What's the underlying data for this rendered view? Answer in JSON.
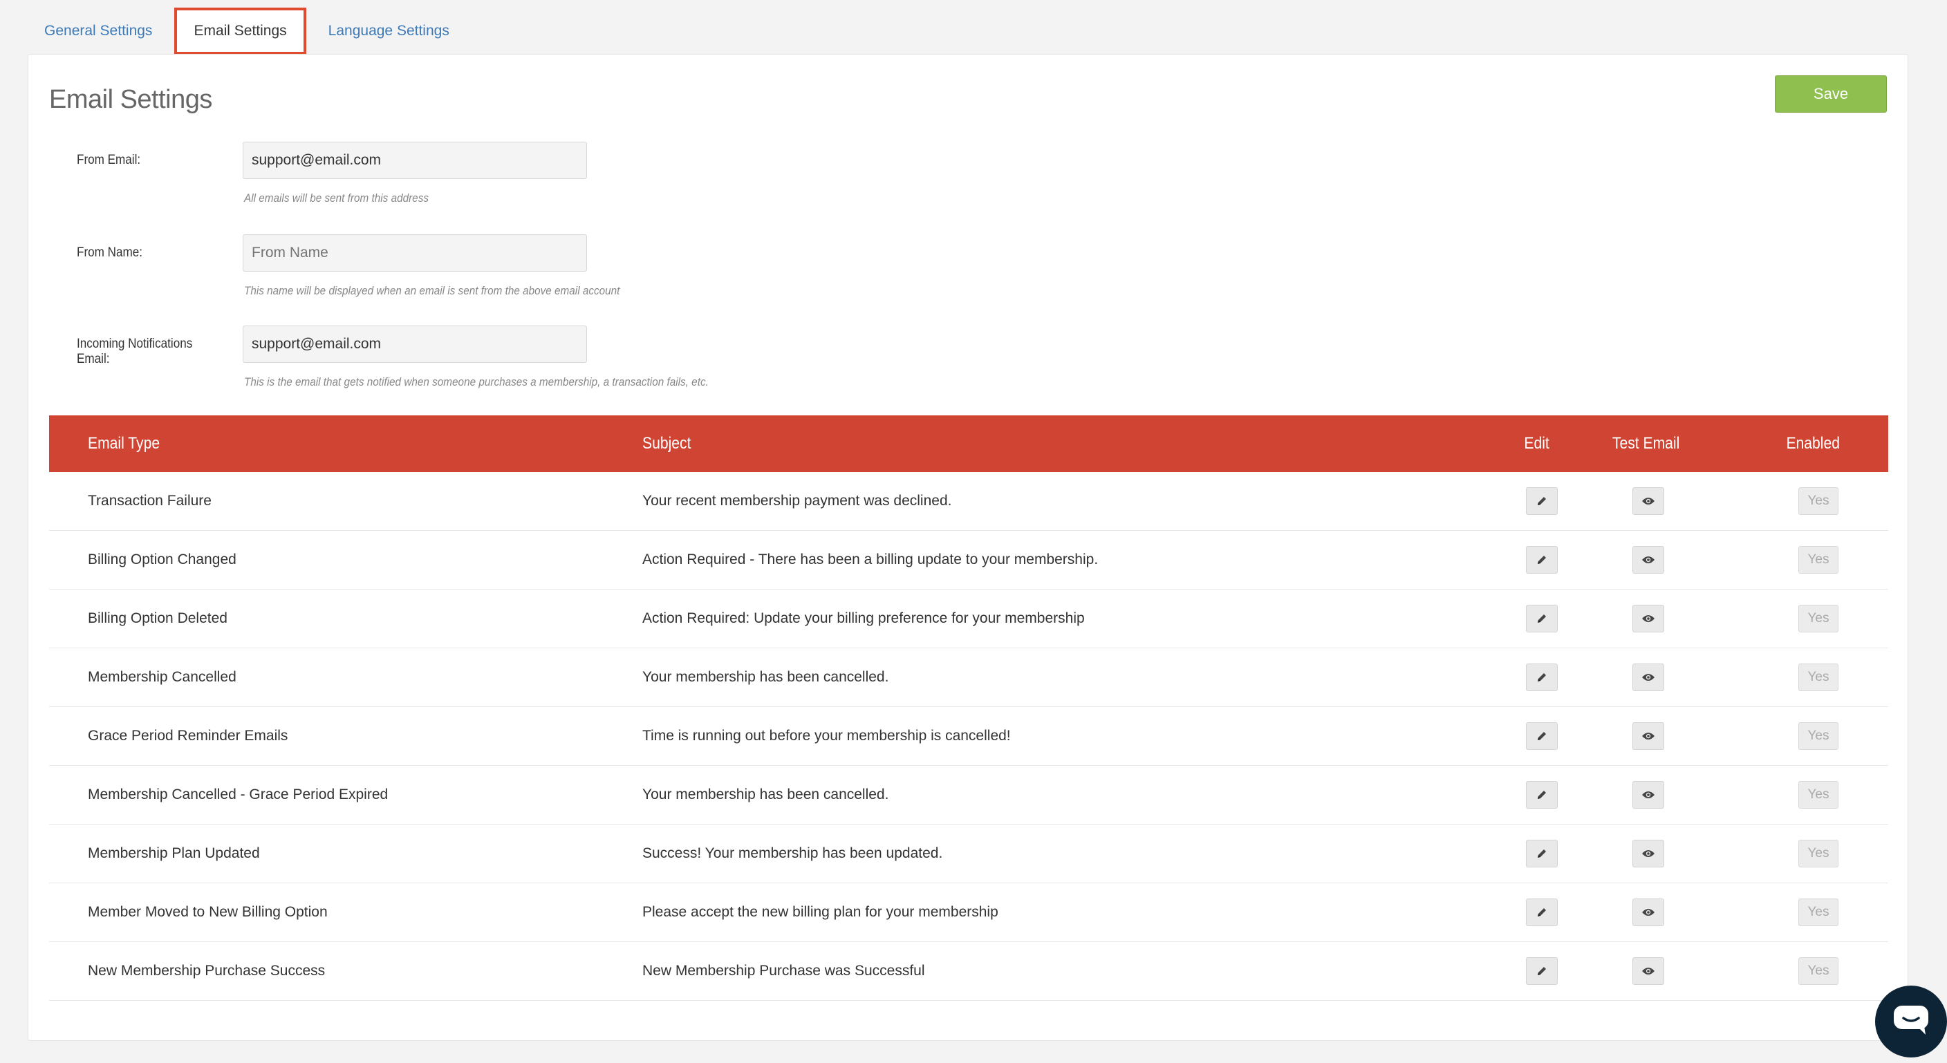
{
  "tabs": [
    {
      "label": "General Settings"
    },
    {
      "label": "Email Settings"
    },
    {
      "label": "Language Settings"
    }
  ],
  "active_tab": "Email Settings",
  "page_title": "Email Settings",
  "save_label": "Save",
  "form": {
    "from_email": {
      "label": "From Email:",
      "value": "support@email.com",
      "help": "All emails will be sent from this address"
    },
    "from_name": {
      "label": "From Name:",
      "value": "",
      "placeholder": "From Name",
      "help": "This name will be displayed when an email is sent from the above email account"
    },
    "notifications_email": {
      "label": "Incoming Notifications Email:",
      "value": "support@email.com",
      "help": "This is the email that gets notified when someone purchases a membership, a transaction fails, etc."
    }
  },
  "table": {
    "headers": {
      "type": "Email Type",
      "subject": "Subject",
      "edit": "Edit",
      "test": "Test Email",
      "enabled": "Enabled"
    },
    "rows": [
      {
        "type": "Transaction Failure",
        "subject": "Your recent membership payment was declined.",
        "enabled": "Yes"
      },
      {
        "type": "Billing Option Changed",
        "subject": "Action Required - There has been a billing update to your membership.",
        "enabled": "Yes"
      },
      {
        "type": "Billing Option Deleted",
        "subject": "Action Required: Update your billing preference for your membership",
        "enabled": "Yes"
      },
      {
        "type": "Membership Cancelled",
        "subject": "Your membership has been cancelled.",
        "enabled": "Yes"
      },
      {
        "type": "Grace Period Reminder Emails",
        "subject": "Time is running out before your membership is cancelled!",
        "enabled": "Yes"
      },
      {
        "type": "Membership Cancelled - Grace Period Expired",
        "subject": "Your membership has been cancelled.",
        "enabled": "Yes"
      },
      {
        "type": "Membership Plan Updated",
        "subject": "Success! Your membership has been updated.",
        "enabled": "Yes"
      },
      {
        "type": "Member Moved to New Billing Option",
        "subject": "Please accept the new billing plan for your membership",
        "enabled": "Yes"
      },
      {
        "type": "New Membership Purchase Success",
        "subject": "New Membership Purchase was Successful",
        "enabled": "Yes"
      }
    ]
  },
  "icons": {
    "edit": "pencil-icon",
    "test": "eye-icon",
    "chat": "chat-bubble-icon"
  },
  "colors": {
    "header_red": "#cf4433",
    "save_green": "#8ebf4f",
    "tab_blue": "#3d7ab8",
    "active_tab_border": "#e04a2f"
  }
}
